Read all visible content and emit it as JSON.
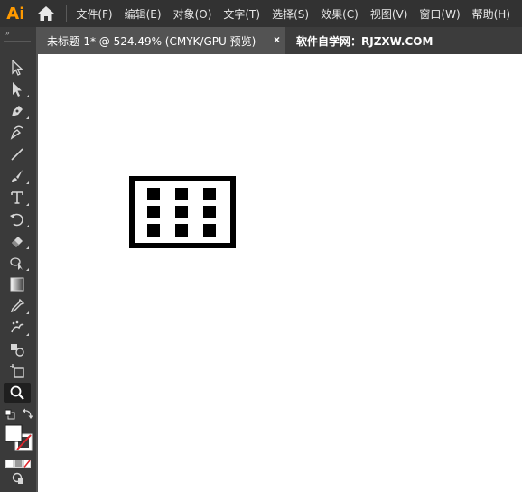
{
  "app": {
    "logo_text": "Ai"
  },
  "menu": {
    "items": [
      "文件(F)",
      "编辑(E)",
      "对象(O)",
      "文字(T)",
      "选择(S)",
      "效果(C)",
      "视图(V)",
      "窗口(W)",
      "帮助(H)"
    ]
  },
  "tab": {
    "title": "未标题-1* @ 524.49% (CMYK/GPU 预览)",
    "close_glyph": "×"
  },
  "watermark": "软件自学网：RJZXW.COM",
  "toolbar": {
    "grip_glyph": "»",
    "tools": [
      "selection-tool",
      "direct-selection-tool",
      "pen-tool",
      "curvature-tool",
      "line-segment-tool",
      "paintbrush-tool",
      "type-tool",
      "rotate-tool",
      "eraser-tool",
      "shape-builder-tool",
      "gradient-tool",
      "eyedropper-tool",
      "symbol-sprayer-tool",
      "live-paint-bucket-tool",
      "artboard-tool",
      "zoom-tool"
    ],
    "active_tool": "zoom-tool"
  },
  "colors": {
    "menubar_bg": "#323232",
    "toolbar_bg": "#3a3a3a",
    "tab_active_bg": "#535353",
    "canvas_bg": "#ffffff",
    "logo_color": "#ff9a00",
    "none_swatch_stroke": "#e0262c"
  },
  "artwork": {
    "description_icon": "grid-icon",
    "rows": 3,
    "cols": 3
  }
}
